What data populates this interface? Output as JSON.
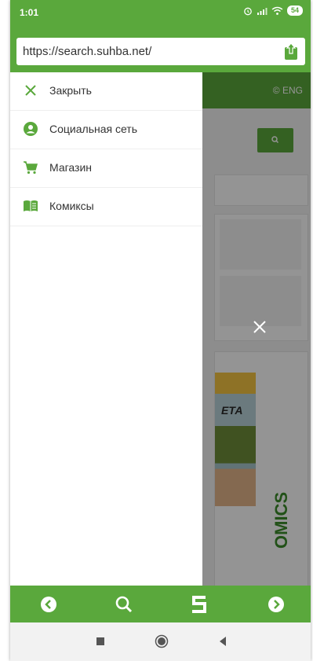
{
  "status": {
    "time": "1:01",
    "battery": "54"
  },
  "browser": {
    "url": "https://search.suhba.net/"
  },
  "page": {
    "lang": "ENG",
    "comic_title": "ЕТА",
    "comics_label": "OMICS"
  },
  "drawer": {
    "items": [
      {
        "label": "Закрыть",
        "icon": "close-icon"
      },
      {
        "label": "Социальная сеть",
        "icon": "user-icon"
      },
      {
        "label": "Магазин",
        "icon": "cart-icon"
      },
      {
        "label": "Комиксы",
        "icon": "book-icon"
      }
    ]
  },
  "colors": {
    "accent": "#5aa83c",
    "drawer_bg": "#ffffff",
    "overlay": "rgba(0,0,0,0.42)"
  }
}
